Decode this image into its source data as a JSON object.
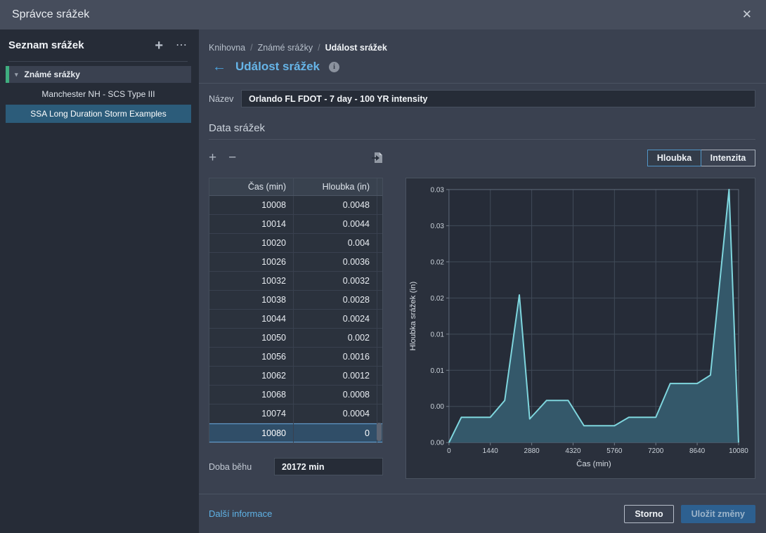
{
  "window": {
    "title": "Správce srážek"
  },
  "icons": {
    "close": "✕",
    "add": "+",
    "overflow": "⋯",
    "chevron_down": "▾",
    "back_arrow": "←",
    "info": "i",
    "remove": "−"
  },
  "sidebar": {
    "title": "Seznam srážek",
    "group": {
      "label": "Známé srážky",
      "accent_color": "#3fae7f"
    },
    "items": [
      {
        "label": "Manchester NH - SCS Type III",
        "selected": false
      },
      {
        "label": "SSA Long Duration Storm Examples",
        "selected": true
      }
    ],
    "selection_color": "#2c5c7a"
  },
  "breadcrumb": {
    "separator": "/",
    "items": [
      "Knihovna",
      "Známé srážky",
      "Událost srážek"
    ]
  },
  "page": {
    "title": "Událost srážek"
  },
  "form": {
    "name_label": "Název",
    "name_value": "Orlando FL FDOT - 7 day - 100 YR intensity"
  },
  "section": {
    "title": "Data srážek"
  },
  "view_toggle": {
    "options": [
      {
        "label": "Hloubka",
        "selected": true
      },
      {
        "label": "Intenzita",
        "selected": false
      }
    ]
  },
  "table": {
    "columns": [
      "Čas (min)",
      "Hloubka (in)"
    ],
    "rows": [
      [
        "10008",
        "0.0048"
      ],
      [
        "10014",
        "0.0044"
      ],
      [
        "10020",
        "0.004"
      ],
      [
        "10026",
        "0.0036"
      ],
      [
        "10032",
        "0.0032"
      ],
      [
        "10038",
        "0.0028"
      ],
      [
        "10044",
        "0.0024"
      ],
      [
        "10050",
        "0.002"
      ],
      [
        "10056",
        "0.0016"
      ],
      [
        "10062",
        "0.0012"
      ],
      [
        "10068",
        "0.0008"
      ],
      [
        "10074",
        "0.0004"
      ],
      [
        "10080",
        "0"
      ]
    ],
    "selected_row_index": 12
  },
  "run_time": {
    "label": "Doba běhu",
    "value": "20172 min"
  },
  "footer": {
    "link": "Další informace",
    "cancel_label": "Storno",
    "save_label": "Uložit změny",
    "save_color": "#2d6090"
  },
  "chart_data": {
    "type": "area",
    "title": "",
    "xlabel": "Čas (min)",
    "ylabel": "Hloubka srážek (in)",
    "xlim": [
      0,
      10080
    ],
    "ylim": [
      0,
      0.03
    ],
    "x_ticks": [
      0,
      1440,
      2880,
      4320,
      5760,
      7200,
      8640,
      10080
    ],
    "y_ticks": [
      0.03,
      0.0257,
      0.0214,
      0.0171,
      0.0129,
      0.0086,
      0.0043,
      0
    ],
    "y_tick_labels_top_to_bottom": [
      "0.03",
      "0.03",
      "0.02",
      "0.02",
      "0.01",
      "0.01",
      "0.00",
      "0.00"
    ],
    "grid": true,
    "legend": "none",
    "line_color": "#7fd6de",
    "fill_color": "#34586a",
    "plot_bg": "#262c38",
    "grid_color": "#414b59",
    "frame_color": "#5b6574",
    "tick_color": "#747d8a",
    "series": [
      {
        "name": "Hloubka srážek",
        "points": [
          [
            0,
            0
          ],
          [
            430,
            0.003
          ],
          [
            1440,
            0.003
          ],
          [
            1940,
            0.005
          ],
          [
            2450,
            0.0175
          ],
          [
            2810,
            0.0028
          ],
          [
            3400,
            0.005
          ],
          [
            4150,
            0.005
          ],
          [
            4700,
            0.002
          ],
          [
            5760,
            0.002
          ],
          [
            6260,
            0.003
          ],
          [
            7200,
            0.003
          ],
          [
            7700,
            0.007
          ],
          [
            8640,
            0.007
          ],
          [
            9100,
            0.008
          ],
          [
            9750,
            0.03
          ],
          [
            10080,
            0
          ]
        ]
      }
    ]
  }
}
